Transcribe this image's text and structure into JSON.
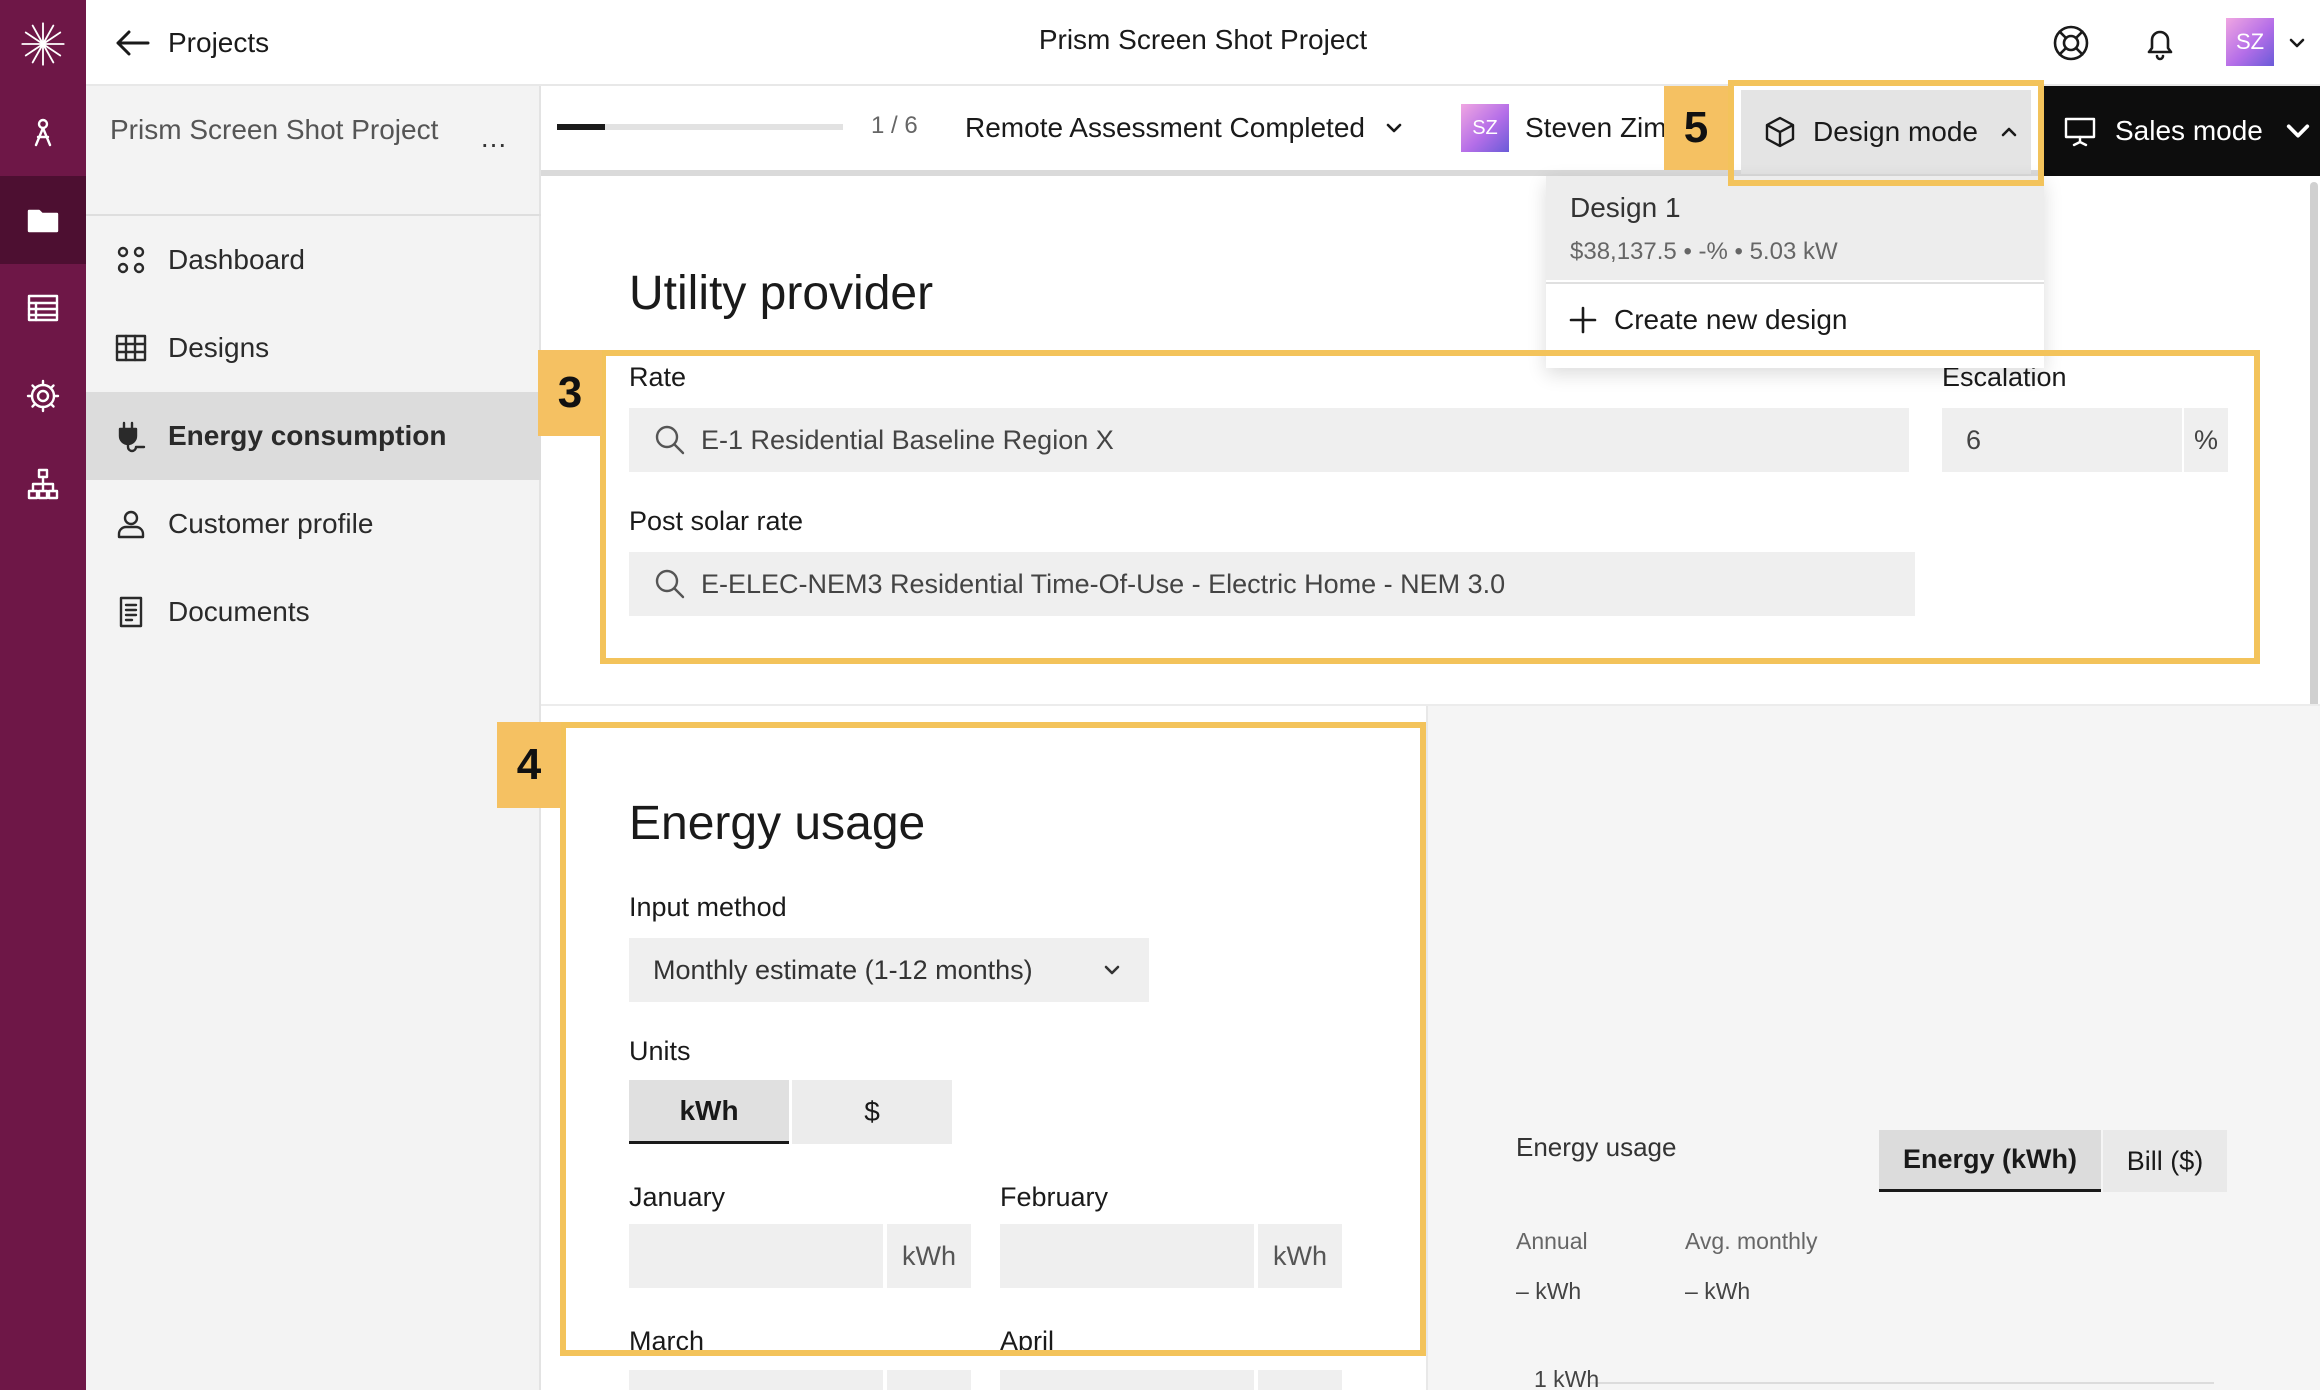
{
  "rail": {
    "icons": [
      "sunburst-logo-icon",
      "solar-panel-icon",
      "folder-icon",
      "table-icon",
      "gear-icon",
      "org-chart-icon"
    ],
    "colors": {
      "background": "#6e1747",
      "active": "#4d0f31"
    }
  },
  "header": {
    "back_label": "Projects",
    "title": "Prism Screen Shot Project",
    "avatar_initials": "SZ"
  },
  "sidebar": {
    "project_name": "Prism Screen Shot Project",
    "more_label": "...",
    "items": [
      {
        "label": "Dashboard",
        "icon": "dashboard-icon"
      },
      {
        "label": "Designs",
        "icon": "grid-icon"
      },
      {
        "label": "Energy consumption",
        "icon": "plug-icon",
        "active": true
      },
      {
        "label": "Customer profile",
        "icon": "person-icon"
      },
      {
        "label": "Documents",
        "icon": "document-icon"
      }
    ]
  },
  "topbar": {
    "progress_fraction": 0.1667,
    "step_count": "1 / 6",
    "status": "Remote Assessment Completed",
    "assignee_initials": "SZ",
    "assignee_name": "Steven Zim",
    "design_mode_label": "Design mode",
    "sales_mode_label": "Sales mode"
  },
  "design_menu": {
    "design_name": "Design 1",
    "design_summary": "$38,137.5 • -% • 5.03 kW",
    "create_label": "Create new design"
  },
  "utility": {
    "title": "Utility provider",
    "rate_label": "Rate",
    "rate_value": "E-1 Residential Baseline Region X",
    "escalation_label": "Escalation",
    "escalation_value": "6",
    "escalation_unit": "%",
    "post_solar_label": "Post solar rate",
    "post_solar_value": "E-ELEC-NEM3 Residential Time-Of-Use - Electric Home - NEM 3.0"
  },
  "energy_usage": {
    "title": "Energy usage",
    "input_method_label": "Input method",
    "input_method_value": "Monthly estimate (1-12 months)",
    "units_label": "Units",
    "units_options": [
      "kWh",
      "$"
    ],
    "months": [
      {
        "label": "January",
        "unit": "kWh"
      },
      {
        "label": "February",
        "unit": "kWh"
      },
      {
        "label": "March",
        "unit": ""
      },
      {
        "label": "April",
        "unit": ""
      }
    ]
  },
  "chart_panel": {
    "title": "Energy usage",
    "toggle": [
      "Energy (kWh)",
      "Bill ($)"
    ],
    "annual_label": "Annual",
    "annual_value": "–",
    "annual_unit": "kWh",
    "monthly_label": "Avg. monthly",
    "monthly_value": "–",
    "monthly_unit": "kWh",
    "axis_label": "1 kWh"
  },
  "annotations": {
    "badges": [
      "3",
      "4",
      "5"
    ],
    "color": "#f3c35b"
  }
}
